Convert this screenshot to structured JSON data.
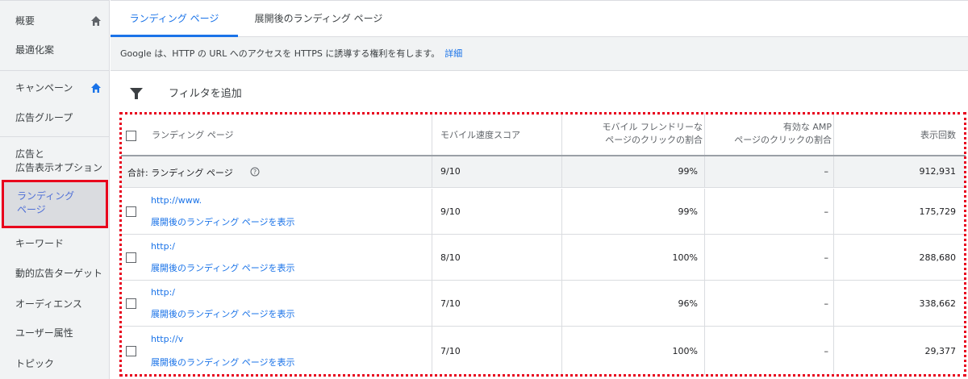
{
  "sidebar": {
    "items": [
      {
        "label": "概要"
      },
      {
        "label": "最適化案"
      },
      {
        "label": "キャンペーン"
      },
      {
        "label": "広告グループ"
      },
      {
        "label": "広告と"
      },
      {
        "label": "広告表示オプション"
      },
      {
        "label": "ランディング"
      },
      {
        "label": "ページ"
      },
      {
        "label": "キーワード"
      },
      {
        "label": "動的広告ターゲット"
      },
      {
        "label": "オーディエンス"
      },
      {
        "label": "ユーザー属性"
      },
      {
        "label": "トピック"
      }
    ]
  },
  "tabs": [
    {
      "label": "ランディング ページ"
    },
    {
      "label": "展開後のランディング ページ"
    }
  ],
  "banner": {
    "text": "Google は、HTTP の URL へのアクセスを HTTPS に誘導する権利を有します。",
    "link": "詳細"
  },
  "filter": {
    "label": "フィルタを追加"
  },
  "table": {
    "headers": {
      "landing_page": "ランディング ページ",
      "mobile_score": "モバイル速度スコア",
      "mobile_friendly_1": "モバイル フレンドリーな",
      "mobile_friendly_2": "ページのクリックの割合",
      "amp_1": "有効な AMP",
      "amp_2": "ページのクリックの割合",
      "impressions": "表示回数"
    },
    "total": {
      "label": "合計: ランディング ページ",
      "score": "9/10",
      "friendly": "99%",
      "amp": "–",
      "impressions": "912,931"
    },
    "rows": [
      {
        "url": "http://www.",
        "expand": "展開後のランディング ページを表示",
        "score": "9/10",
        "friendly": "99%",
        "amp": "–",
        "impressions": "175,729"
      },
      {
        "url": "http:/",
        "expand": "展開後のランディング ページを表示",
        "score": "8/10",
        "friendly": "100%",
        "amp": "–",
        "impressions": "288,680"
      },
      {
        "url": "http:/",
        "expand": "展開後のランディング ページを表示",
        "score": "7/10",
        "friendly": "96%",
        "amp": "–",
        "impressions": "338,662"
      },
      {
        "url": "http://v",
        "expand": "展開後のランディング ページを表示",
        "score": "7/10",
        "friendly": "100%",
        "amp": "–",
        "impressions": "29,377"
      }
    ]
  },
  "colors": {
    "accent": "#1a73e8",
    "highlight": "#e8001d",
    "panel": "#f1f3f4"
  }
}
